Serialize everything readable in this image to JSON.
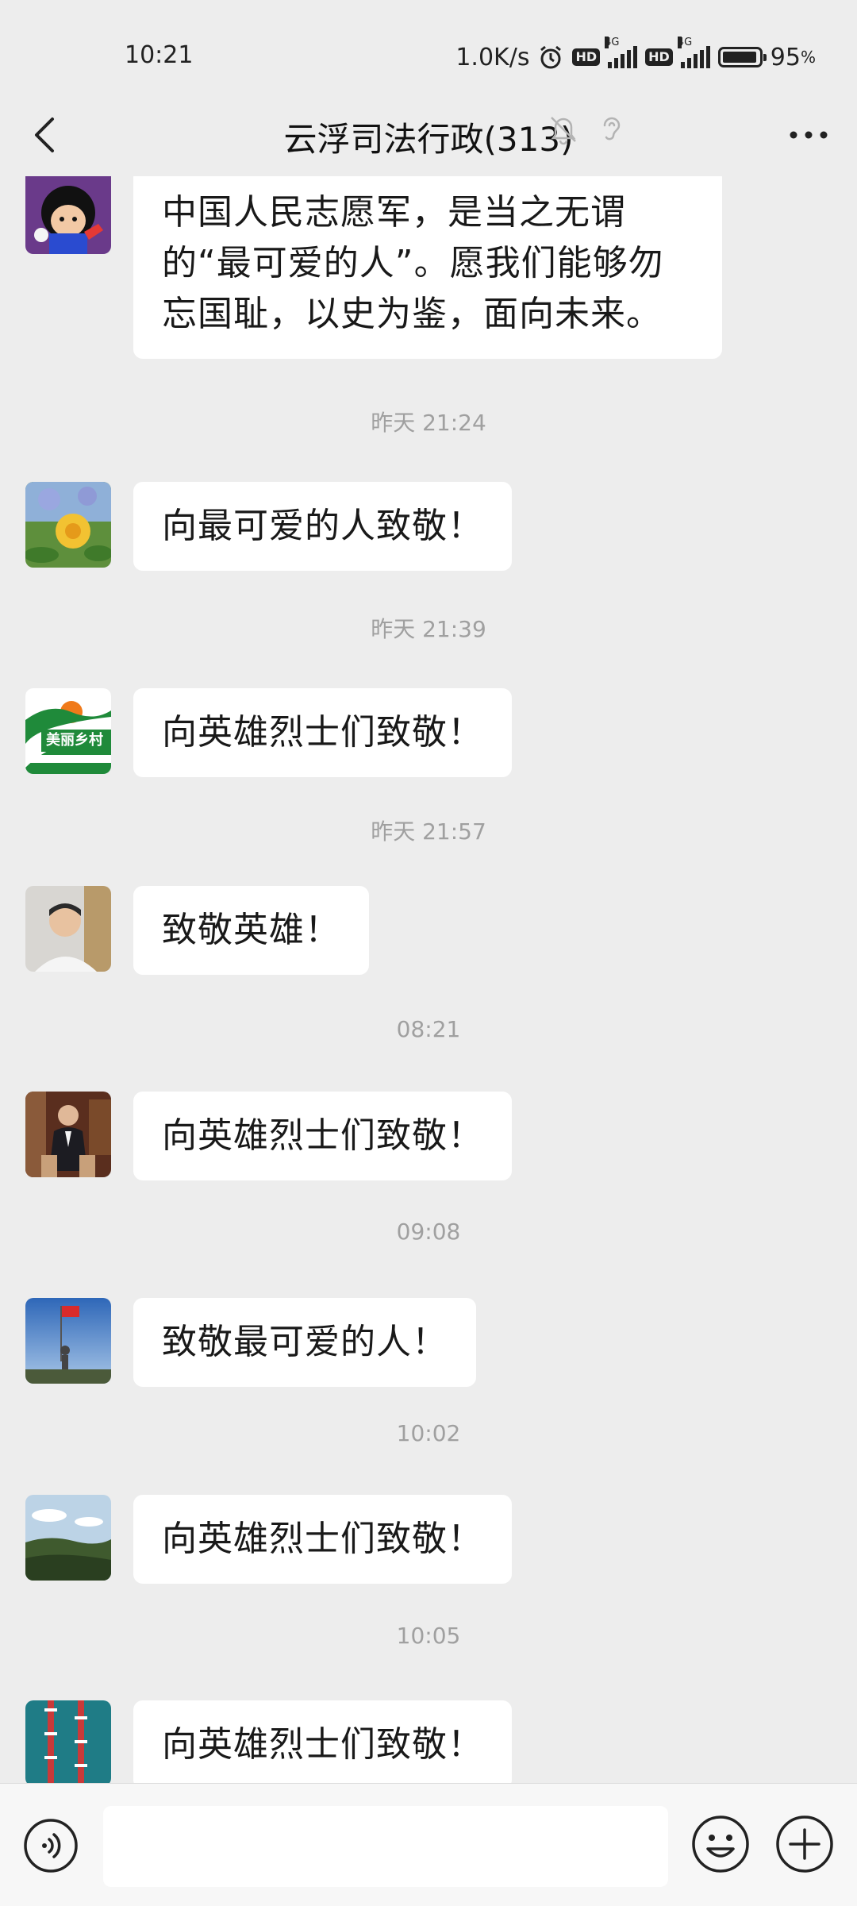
{
  "status_bar": {
    "time": "10:21",
    "net_speed": "1.0K/s",
    "hd1": "HD",
    "sig1_tag": "4G",
    "hd2": "HD",
    "sig2_tag": "4G",
    "battery_percent": "95",
    "battery_suffix": "%",
    "battery_level": 0.95
  },
  "header": {
    "title": "云浮司法行政(313)",
    "icons": [
      "back-icon",
      "bell-muted-icon",
      "ear-icon",
      "more-icon"
    ]
  },
  "messages": [
    {
      "type": "message",
      "text": "中国人民志愿军，是当之无谓的“最可爱的人”。愿我们能够勿忘国耻，以史为鉴，面向未来。",
      "avatar": "cartoon-avatar"
    },
    {
      "type": "time",
      "text": "昨天 21:24"
    },
    {
      "type": "message",
      "text": "向最可爱的人致敬！",
      "avatar": "flower-avatar"
    },
    {
      "type": "time",
      "text": "昨天 21:39"
    },
    {
      "type": "message",
      "text": "向英雄烈士们致敬！",
      "avatar": "village-logo-avatar",
      "avatar_text": "美丽乡村"
    },
    {
      "type": "time",
      "text": "昨天 21:57"
    },
    {
      "type": "message",
      "text": "致敬英雄！",
      "avatar": "man-portrait-avatar"
    },
    {
      "type": "time",
      "text": "08:21"
    },
    {
      "type": "message",
      "text": "向英雄烈士们致敬！",
      "avatar": "man-suit-avatar"
    },
    {
      "type": "time",
      "text": "09:08"
    },
    {
      "type": "message",
      "text": "致敬最可爱的人！",
      "avatar": "flag-sky-avatar"
    },
    {
      "type": "time",
      "text": "10:02"
    },
    {
      "type": "message",
      "text": "向英雄烈士们致敬！",
      "avatar": "landscape-avatar"
    },
    {
      "type": "time",
      "text": "10:05"
    },
    {
      "type": "message",
      "text": "向英雄烈士们致敬！",
      "avatar": "boats-avatar"
    }
  ],
  "input_bar": {
    "placeholder": "",
    "icons": [
      "voice-icon",
      "emoji-icon",
      "add-icon"
    ]
  },
  "colors": {
    "background": "#ededed",
    "bubble": "#ffffff",
    "timestamp": "#a0a0a0",
    "bottom_bar": "#f7f7f7"
  }
}
